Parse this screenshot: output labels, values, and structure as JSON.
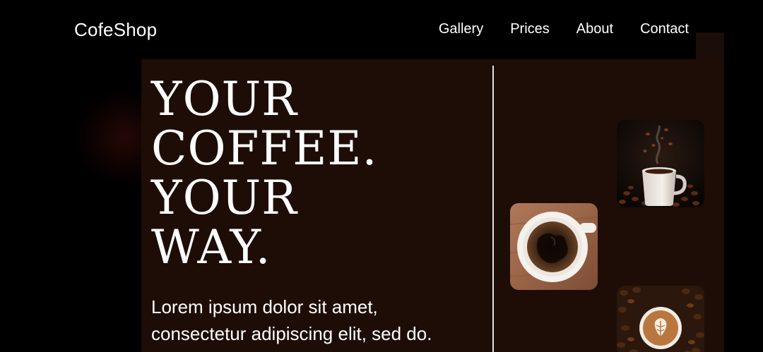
{
  "brand": {
    "name": "CofeShop"
  },
  "nav": {
    "items": [
      {
        "label": "Gallery"
      },
      {
        "label": "Prices"
      },
      {
        "label": "About"
      },
      {
        "label": "Contact"
      }
    ]
  },
  "hero": {
    "headline": [
      "YOUR",
      "COFFEE.",
      "YOUR",
      "WAY."
    ],
    "tagline": [
      "Lorem ipsum dolor sit amet,",
      "consectetur adipiscing elit, sed do."
    ]
  },
  "gallery": {
    "images": [
      {
        "name": "steaming-coffee-cup-with-beans"
      },
      {
        "name": "black-coffee-top-view"
      },
      {
        "name": "latte-art-on-beans"
      }
    ]
  },
  "colors": {
    "background": "#000000",
    "panel": "#1e0d07",
    "text": "#ffffff",
    "divider": "#e8e0dc"
  }
}
